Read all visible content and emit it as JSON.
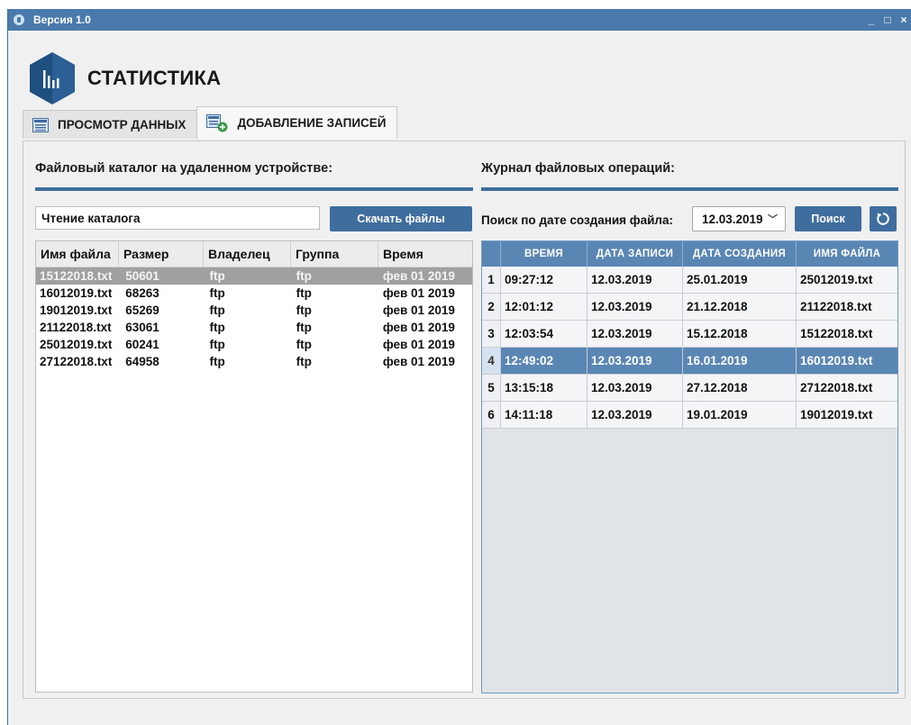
{
  "window": {
    "title": "Версия 1.0",
    "minimize": "_",
    "maximize": "□",
    "close": "×"
  },
  "app": {
    "title": "СТАТИСТИКА"
  },
  "tabs": [
    {
      "label": "ПРОСМОТР ДАННЫХ",
      "active": false
    },
    {
      "label": "ДОБАВЛЕНИЕ ЗАПИСЕЙ",
      "active": true
    }
  ],
  "left": {
    "title": "Файловый каталог на удаленном устройстве:",
    "path_value": "Чтение каталога",
    "download_label": "Скачать файлы",
    "columns": [
      "Имя файла",
      "Размер",
      "Владелец",
      "Группа",
      "Время"
    ],
    "rows": [
      {
        "name": "15122018.txt",
        "size": "50601",
        "owner": "ftp",
        "group": "ftp",
        "time": "фев 01 2019",
        "selected": true
      },
      {
        "name": "16012019.txt",
        "size": "68263",
        "owner": "ftp",
        "group": "ftp",
        "time": "фев 01 2019"
      },
      {
        "name": "19012019.txt",
        "size": "65269",
        "owner": "ftp",
        "group": "ftp",
        "time": "фев 01 2019"
      },
      {
        "name": "21122018.txt",
        "size": "63061",
        "owner": "ftp",
        "group": "ftp",
        "time": "фев 01 2019"
      },
      {
        "name": "25012019.txt",
        "size": "60241",
        "owner": "ftp",
        "group": "ftp",
        "time": "фев 01 2019"
      },
      {
        "name": "27122018.txt",
        "size": "64958",
        "owner": "ftp",
        "group": "ftp",
        "time": "фев 01 2019"
      }
    ]
  },
  "right": {
    "title": "Журнал файловых операций:",
    "search_label": "Поиск по дате создания файла:",
    "date_value": "12.03.2019",
    "search_button": "Поиск",
    "columns": [
      "ВРЕМЯ",
      "ДАТА ЗАПИСИ",
      "ДАТА СОЗДАНИЯ",
      "ИМЯ ФАЙЛА"
    ],
    "rows": [
      {
        "n": "1",
        "time": "09:27:12",
        "record_date": "12.03.2019",
        "created": "25.01.2019",
        "file": "25012019.txt"
      },
      {
        "n": "2",
        "time": "12:01:12",
        "record_date": "12.03.2019",
        "created": "21.12.2018",
        "file": "21122018.txt"
      },
      {
        "n": "3",
        "time": "12:03:54",
        "record_date": "12.03.2019",
        "created": "15.12.2018",
        "file": "15122018.txt"
      },
      {
        "n": "4",
        "time": "12:49:02",
        "record_date": "12.03.2019",
        "created": "16.01.2019",
        "file": "16012019.txt",
        "selected": true
      },
      {
        "n": "5",
        "time": "13:15:18",
        "record_date": "12.03.2019",
        "created": "27.12.2018",
        "file": "27122018.txt"
      },
      {
        "n": "6",
        "time": "14:11:18",
        "record_date": "12.03.2019",
        "created": "19.01.2019",
        "file": "19012019.txt"
      }
    ]
  },
  "colors": {
    "accent": "#3f6e9e",
    "header_blue": "#5a86b4",
    "selected_gray": "#a0a0a0"
  }
}
